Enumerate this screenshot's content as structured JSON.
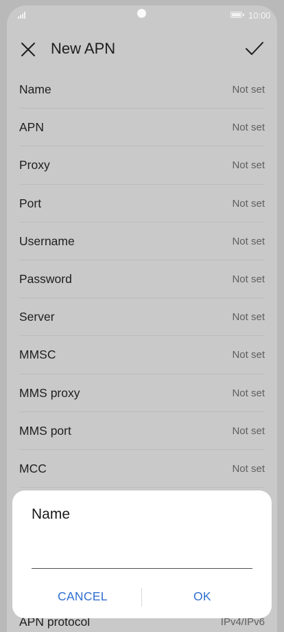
{
  "status_bar": {
    "time": "10:00",
    "battery_icon": "battery-icon",
    "signal_icon": "signal-icon"
  },
  "header": {
    "title": "New APN",
    "close_icon": "close-icon",
    "confirm_icon": "check-icon"
  },
  "fields": [
    {
      "label": "Name",
      "value": "Not set"
    },
    {
      "label": "APN",
      "value": "Not set"
    },
    {
      "label": "Proxy",
      "value": "Not set"
    },
    {
      "label": "Port",
      "value": "Not set"
    },
    {
      "label": "Username",
      "value": "Not set"
    },
    {
      "label": "Password",
      "value": "Not set"
    },
    {
      "label": "Server",
      "value": "Not set"
    },
    {
      "label": "MMSC",
      "value": "Not set"
    },
    {
      "label": "MMS proxy",
      "value": "Not set"
    },
    {
      "label": "MMS port",
      "value": "Not set"
    },
    {
      "label": "MCC",
      "value": "Not set"
    }
  ],
  "peek_field": {
    "label": "APN protocol",
    "value": "IPv4/IPv6"
  },
  "dialog": {
    "title": "Name",
    "input_value": "",
    "cancel_label": "CANCEL",
    "ok_label": "OK"
  },
  "colors": {
    "accent": "#2f6fd0",
    "scrim": "#c9c9c9"
  }
}
